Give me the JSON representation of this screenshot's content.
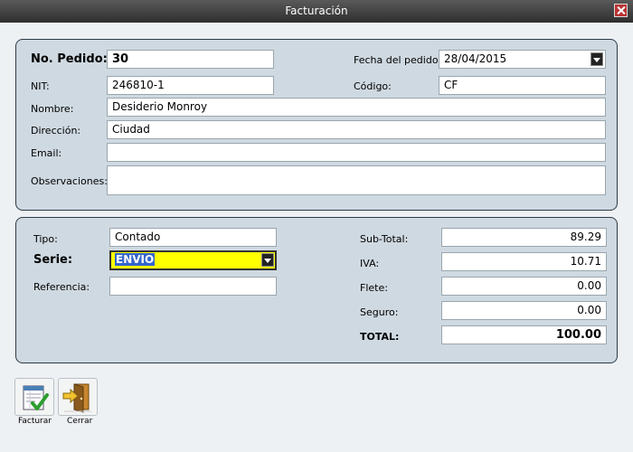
{
  "window": {
    "title": "Facturación"
  },
  "header_form": {
    "pedido_label": "No. Pedido:",
    "pedido_value": "30",
    "fecha_label": "Fecha del pedido:",
    "fecha_value": "28/04/2015",
    "nit_label": "NIT:",
    "nit_value": "246810-1",
    "codigo_label": "Código:",
    "codigo_value": "CF",
    "nombre_label": "Nombre:",
    "nombre_value": "Desiderio Monroy",
    "direccion_label": "Dirección:",
    "direccion_value": "Ciudad",
    "email_label": "Email:",
    "email_value": "",
    "observaciones_label": "Observaciones:",
    "observaciones_value": ""
  },
  "billing": {
    "tipo_label": "Tipo:",
    "tipo_value": "Contado",
    "serie_label": "Serie:",
    "serie_value": "ENVIO",
    "referencia_label": "Referencia:",
    "referencia_value": "",
    "subtotal_label": "Sub-Total:",
    "subtotal_value": "89.29",
    "iva_label": "IVA:",
    "iva_value": "10.71",
    "flete_label": "Flete:",
    "flete_value": "0.00",
    "seguro_label": "Seguro:",
    "seguro_value": "0.00",
    "total_label": "TOTAL:",
    "total_value": "100.00"
  },
  "toolbar": {
    "facturar_label": "Facturar",
    "cerrar_label": "Cerrar",
    "facturar_icon": "invoice-check-icon",
    "cerrar_icon": "exit-door-icon"
  },
  "colors": {
    "serie_highlight": "#ffff00",
    "panel_bg": "#cfd9e1"
  }
}
